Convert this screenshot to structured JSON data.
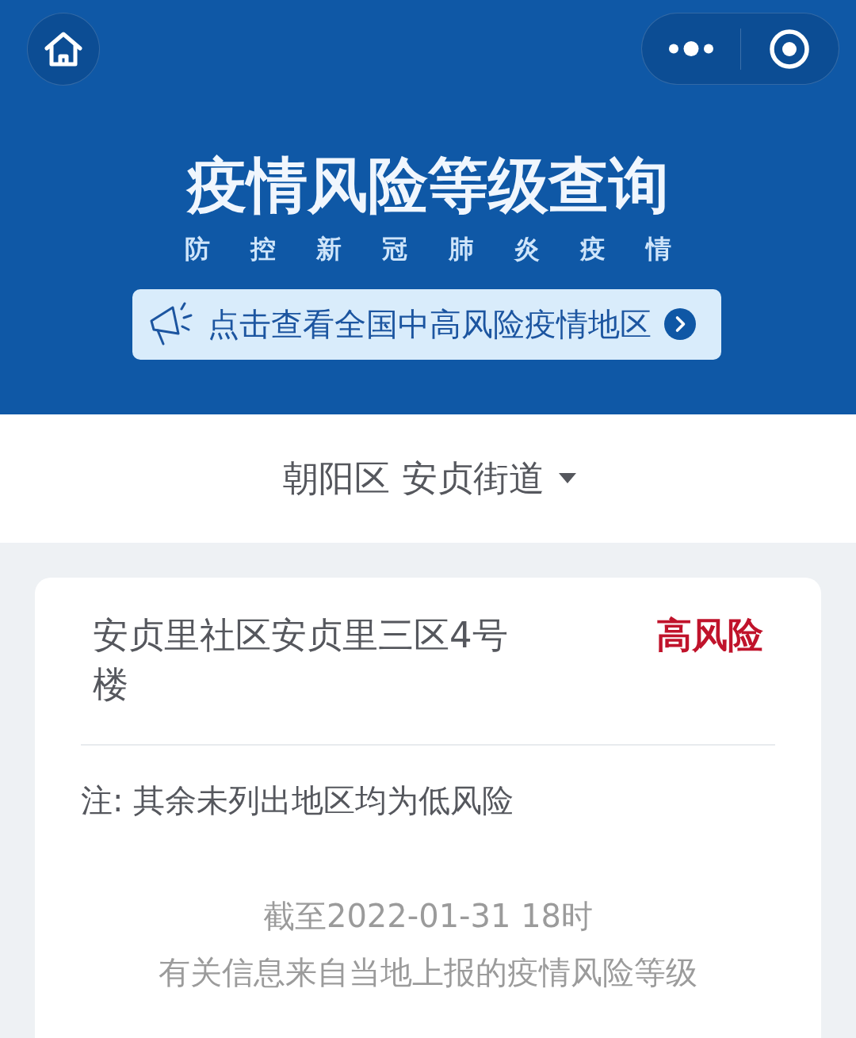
{
  "header": {
    "title": "疫情风险等级查询",
    "subtitle": "防 控 新 冠 肺 炎 疫 情",
    "banner": {
      "label": "点击查看全国中高风险疫情地区"
    }
  },
  "location_selector": {
    "label": "朝阳区 安贞街道"
  },
  "results": [
    {
      "place": "安贞里社区安贞里三区4号楼",
      "risk": "高风险",
      "color": "#c0132b"
    }
  ],
  "note": "注: 其余未列出地区均为低风险",
  "footer": [
    "截至2022-01-31 18时",
    "有关信息来自当地上报的疫情风险等级"
  ]
}
